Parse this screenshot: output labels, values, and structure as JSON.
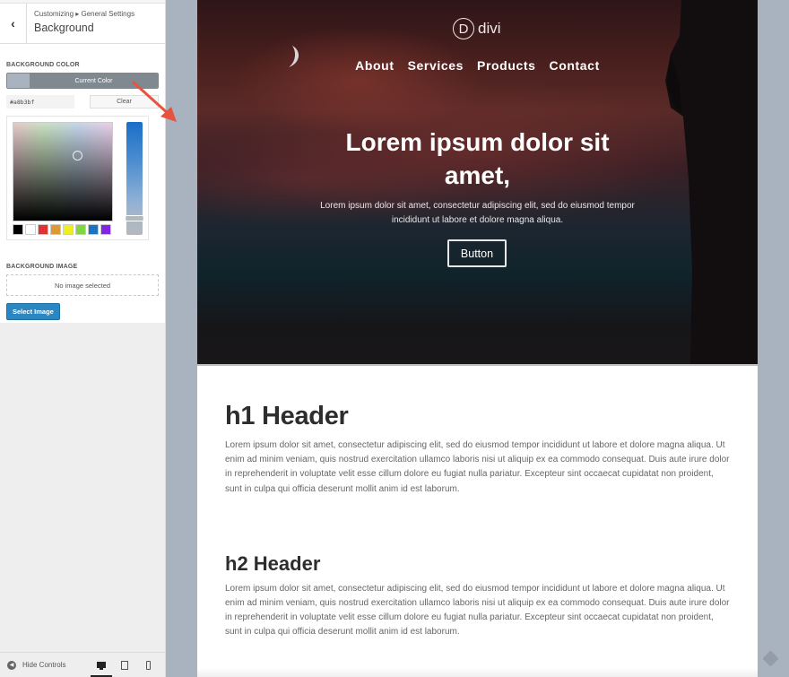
{
  "sidebar": {
    "breadcrumb": "Customizing ▸ General Settings",
    "title": "Background",
    "back_icon": "‹",
    "background_color": {
      "label": "Background Color",
      "current_color_label": "Current Color",
      "hex_value": "#a8b3bf",
      "clear_label": "Clear",
      "palette": [
        "#000000",
        "#ffffff",
        "#dd3333",
        "#dd9933",
        "#eeee22",
        "#81d742",
        "#1e73be",
        "#8224e3"
      ]
    },
    "background_image": {
      "label": "Background Image",
      "placeholder": "No image selected",
      "select_label": "Select Image"
    },
    "footer": {
      "hide_controls_label": "Hide Controls",
      "devices": [
        "desktop",
        "tablet",
        "mobile"
      ],
      "active_device": "desktop"
    }
  },
  "preview": {
    "logo_letter": "D",
    "logo_text": "divi",
    "nav": [
      "About",
      "Services",
      "Products",
      "Contact"
    ],
    "hero": {
      "title": "Lorem ipsum dolor sit amet,",
      "subtitle": "Lorem ipsum dolor sit amet, consectetur adipiscing elit, sed do eiusmod tempor incididunt ut labore et dolore magna aliqua.",
      "button_label": "Button"
    },
    "sections": [
      {
        "heading": "h1 Header",
        "body": "Lorem ipsum dolor sit amet, consectetur adipiscing elit, sed do eiusmod tempor incididunt ut labore et dolore magna aliqua. Ut enim ad minim veniam, quis nostrud exercitation ullamco laboris nisi ut aliquip ex ea commodo consequat. Duis aute irure dolor in reprehenderit in voluptate velit esse cillum dolore eu fugiat nulla pariatur. Excepteur sint occaecat cupidatat non proident, sunt in culpa qui officia deserunt mollit anim id est laborum."
      },
      {
        "heading": "h2 Header",
        "body": "Lorem ipsum dolor sit amet, consectetur adipiscing elit, sed do eiusmod tempor incididunt ut labore et dolore magna aliqua. Ut enim ad minim veniam, quis nostrud exercitation ullamco laboris nisi ut aliquip ex ea commodo consequat. Duis aute irure dolor in reprehenderit in voluptate velit esse cillum dolore eu fugiat nulla pariatur. Excepteur sint occaecat cupidatat non proident, sunt in culpa qui officia deserunt mollit anim id est laborum."
      }
    ]
  },
  "colors": {
    "page_background": "#a8b3bf",
    "annotation_arrow": "#e8533f",
    "select_button": "#2a87c2"
  }
}
